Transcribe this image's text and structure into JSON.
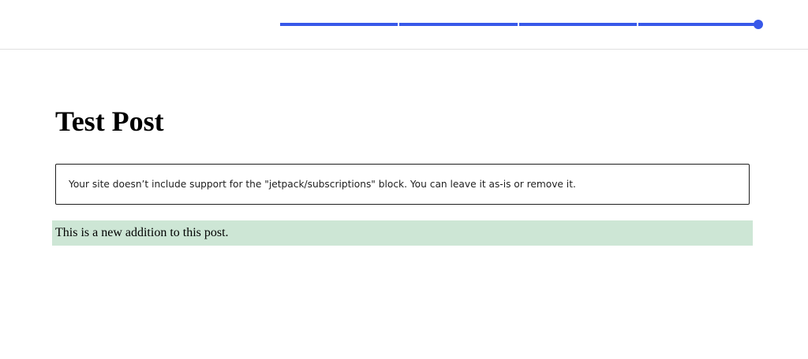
{
  "theme": {
    "accent": "#3858e9",
    "addition_highlight": "#cde6d5"
  },
  "revisions": {
    "segment_count": 4,
    "selected_index": 4
  },
  "post": {
    "title": "Test Post",
    "notice_text": "Your site doesn’t include support for the \"jetpack/subscriptions\" block. You can leave it as-is or remove it.",
    "added_paragraph": "This is a new addition to this post."
  }
}
